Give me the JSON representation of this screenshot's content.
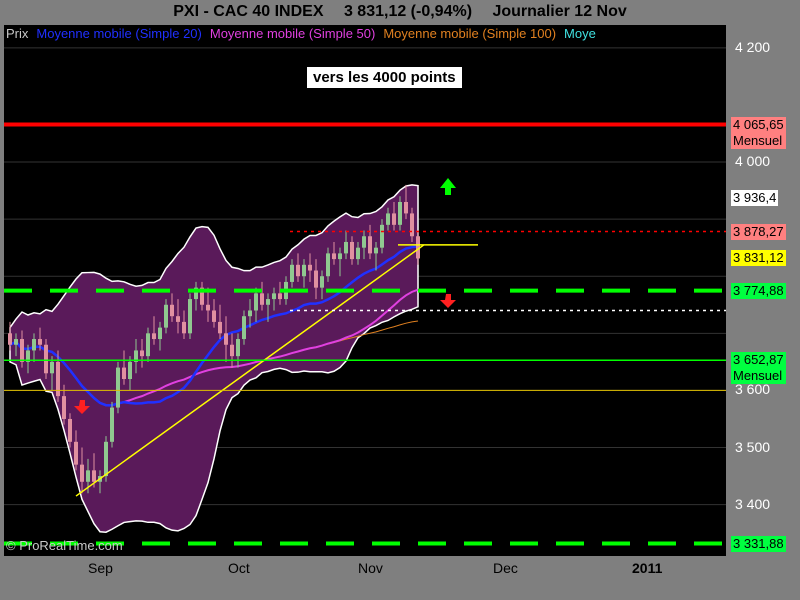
{
  "title": {
    "ticker": "PXI - CAC 40 INDEX",
    "price": "3 831,12 (-0,94%)",
    "period": "Journalier  12 Nov"
  },
  "legend": [
    {
      "text": "Prix",
      "color": "#c8c8c8"
    },
    {
      "text": "Moyenne mobile (Simple 20)",
      "color": "#2030ff"
    },
    {
      "text": "Moyenne mobile (Simple 50)",
      "color": "#e040e0"
    },
    {
      "text": "Moyenne mobile (Simple 100)",
      "color": "#e08020"
    },
    {
      "text": "Moye",
      "color": "#40e0e0"
    }
  ],
  "annotation": "vers les 4000 points",
  "watermark": "© ProRealTime.com",
  "colors": {
    "plot_bg": "#000000",
    "bollinger_fill": "#5a1a5a",
    "up_candle": "#90c890",
    "down_candle": "#e090a0",
    "sma20": "#2030ff",
    "sma50": "#e040e0",
    "sma100": "#e08020",
    "sma200": "#40c0c0",
    "resistance_red": "#ff0000",
    "support_green": "#00ff00",
    "trend_yellow": "#ffff00"
  },
  "chart_data": {
    "type": "candlestick",
    "title": "PXI - CAC 40 INDEX",
    "ylim": [
      3310,
      4240
    ],
    "y_ticks": [
      "4 200",
      "4 000",
      "3 600",
      "3 500",
      "3 400"
    ],
    "x_ticks": [
      "Sep",
      "Oct",
      "Nov",
      "Dec",
      "2011"
    ],
    "price_labels": [
      {
        "value": 4065.65,
        "text": "4 065,65",
        "sub": "Mensuel",
        "bg": "#ff8080"
      },
      {
        "value": 3936.4,
        "text": "3 936,4",
        "bg": "#ffffff"
      },
      {
        "value": 3878.27,
        "text": "3 878,27",
        "bg": "#ff8080"
      },
      {
        "value": 3831.12,
        "text": "3 831,12",
        "bg": "#ffff00"
      },
      {
        "value": 3774.88,
        "text": "3 774,88",
        "bg": "#00ff40"
      },
      {
        "value": 3652.87,
        "text": "3 652,87",
        "sub": "Mensuel",
        "bg": "#00ff40"
      },
      {
        "value": 3331.88,
        "text": "3 331,88",
        "bg": "#00ff40"
      }
    ],
    "candles": [
      [
        3700,
        3720,
        3670,
        3680
      ],
      [
        3680,
        3700,
        3660,
        3690
      ],
      [
        3690,
        3705,
        3640,
        3650
      ],
      [
        3650,
        3680,
        3630,
        3670
      ],
      [
        3670,
        3700,
        3650,
        3690
      ],
      [
        3690,
        3710,
        3670,
        3680
      ],
      [
        3680,
        3690,
        3620,
        3630
      ],
      [
        3630,
        3660,
        3600,
        3650
      ],
      [
        3650,
        3670,
        3580,
        3590
      ],
      [
        3590,
        3610,
        3540,
        3550
      ],
      [
        3550,
        3560,
        3500,
        3510
      ],
      [
        3510,
        3530,
        3460,
        3470
      ],
      [
        3470,
        3500,
        3420,
        3440
      ],
      [
        3440,
        3480,
        3420,
        3460
      ],
      [
        3460,
        3490,
        3430,
        3440
      ],
      [
        3440,
        3460,
        3420,
        3450
      ],
      [
        3450,
        3520,
        3440,
        3510
      ],
      [
        3510,
        3580,
        3500,
        3570
      ],
      [
        3570,
        3650,
        3560,
        3640
      ],
      [
        3640,
        3670,
        3610,
        3620
      ],
      [
        3620,
        3660,
        3600,
        3650
      ],
      [
        3650,
        3690,
        3630,
        3670
      ],
      [
        3670,
        3690,
        3640,
        3660
      ],
      [
        3660,
        3710,
        3650,
        3700
      ],
      [
        3700,
        3730,
        3680,
        3690
      ],
      [
        3690,
        3720,
        3670,
        3710
      ],
      [
        3710,
        3760,
        3700,
        3750
      ],
      [
        3750,
        3770,
        3720,
        3730
      ],
      [
        3730,
        3760,
        3700,
        3720
      ],
      [
        3720,
        3740,
        3690,
        3700
      ],
      [
        3700,
        3770,
        3690,
        3760
      ],
      [
        3760,
        3790,
        3740,
        3780
      ],
      [
        3780,
        3790,
        3740,
        3750
      ],
      [
        3750,
        3780,
        3720,
        3740
      ],
      [
        3740,
        3760,
        3710,
        3720
      ],
      [
        3720,
        3750,
        3690,
        3700
      ],
      [
        3700,
        3730,
        3650,
        3680
      ],
      [
        3680,
        3700,
        3640,
        3660
      ],
      [
        3660,
        3700,
        3640,
        3690
      ],
      [
        3690,
        3740,
        3680,
        3730
      ],
      [
        3730,
        3760,
        3710,
        3740
      ],
      [
        3740,
        3780,
        3720,
        3770
      ],
      [
        3770,
        3790,
        3740,
        3750
      ],
      [
        3750,
        3770,
        3720,
        3760
      ],
      [
        3760,
        3780,
        3740,
        3770
      ],
      [
        3770,
        3790,
        3750,
        3760
      ],
      [
        3760,
        3800,
        3750,
        3790
      ],
      [
        3790,
        3830,
        3780,
        3820
      ],
      [
        3820,
        3840,
        3790,
        3800
      ],
      [
        3800,
        3830,
        3780,
        3820
      ],
      [
        3820,
        3840,
        3790,
        3810
      ],
      [
        3810,
        3830,
        3760,
        3780
      ],
      [
        3780,
        3810,
        3760,
        3800
      ],
      [
        3800,
        3850,
        3790,
        3840
      ],
      [
        3840,
        3860,
        3820,
        3830
      ],
      [
        3830,
        3850,
        3800,
        3840
      ],
      [
        3840,
        3880,
        3830,
        3860
      ],
      [
        3860,
        3870,
        3820,
        3830
      ],
      [
        3830,
        3860,
        3820,
        3850
      ],
      [
        3850,
        3880,
        3830,
        3870
      ],
      [
        3870,
        3890,
        3830,
        3840
      ],
      [
        3840,
        3860,
        3810,
        3850
      ],
      [
        3850,
        3900,
        3840,
        3890
      ],
      [
        3890,
        3920,
        3880,
        3910
      ],
      [
        3910,
        3930,
        3880,
        3890
      ],
      [
        3890,
        3940,
        3880,
        3930
      ],
      [
        3930,
        3960,
        3900,
        3910
      ],
      [
        3910,
        3920,
        3860,
        3870
      ],
      [
        3870,
        3880,
        3820,
        3831.12
      ]
    ]
  }
}
